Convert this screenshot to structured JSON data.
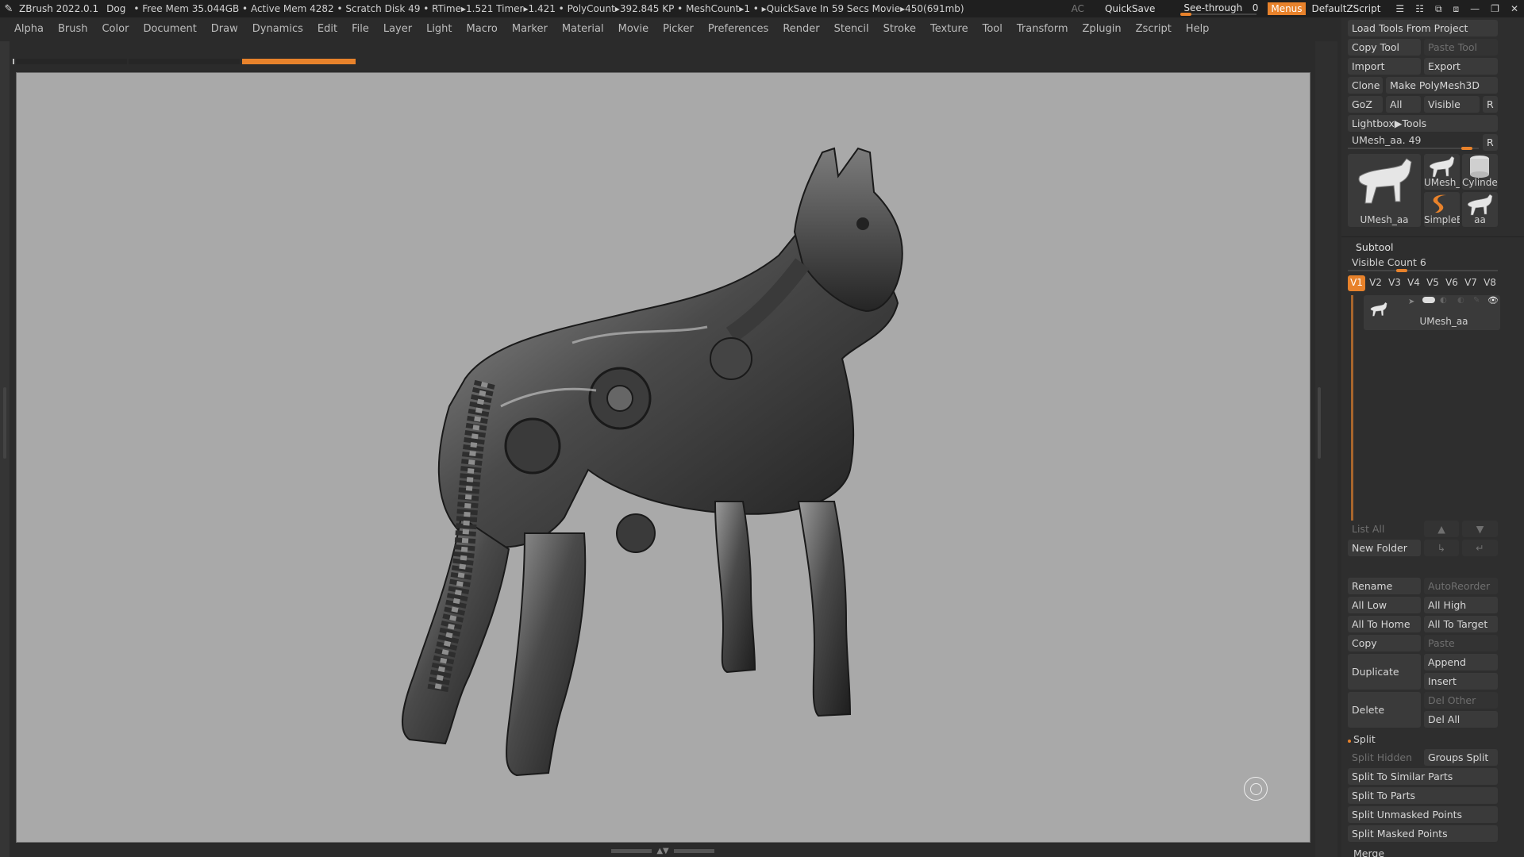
{
  "titlebar": {
    "app_name": "ZBrush 2022.0.1",
    "document": "Dog",
    "status": "• Free Mem 35.044GB • Active Mem 4282 • Scratch Disk 49 • RTime▸1.521 Timer▸1.421 • PolyCount▸392.845 KP • MeshCount▸1 • ▸QuickSave In 59 Secs Movie▸450(691mb)",
    "ac": "AC",
    "quicksave": "QuickSave",
    "see_through_label": "See-through",
    "see_through_value": "0",
    "see_through_level": 0,
    "menus": "Menus",
    "script": "DefaultZScript"
  },
  "menubar": [
    "Alpha",
    "Brush",
    "Color",
    "Document",
    "Draw",
    "Dynamics",
    "Edit",
    "File",
    "Layer",
    "Light",
    "Macro",
    "Marker",
    "Material",
    "Movie",
    "Picker",
    "Preferences",
    "Render",
    "Stencil",
    "Stroke",
    "Texture",
    "Tool",
    "Transform",
    "Zplugin",
    "Zscript",
    "Help"
  ],
  "colors": {
    "accent": "#e8822b",
    "canvas_bg": "#a9a9a9",
    "panel_bg": "#2e2e2e",
    "button_bg": "#3a3a3a"
  },
  "tool_panel": {
    "load_tools": "Load Tools From Project",
    "copy_tool": "Copy Tool",
    "paste_tool": "Paste Tool",
    "import": "Import",
    "export": "Export",
    "clone": "Clone",
    "make_polymesh": "Make PolyMesh3D",
    "goz": "GoZ",
    "all": "All",
    "visible": "Visible",
    "r": "R",
    "lightbox_tools": "Lightbox▶Tools",
    "current_tool": "UMesh_aa. 49",
    "current_tool_slider": 0.95,
    "thumbs": {
      "main": "UMesh_aa",
      "small1": "UMesh_",
      "small2": "Cylinder",
      "small3": "SimpleB",
      "small4": "aa"
    }
  },
  "subtool": {
    "title": "Subtool",
    "visible_count": "Visible Count 6",
    "visible_count_level": 0.35,
    "versions": [
      "V1",
      "V2",
      "V3",
      "V4",
      "V5",
      "V6",
      "V7",
      "V8"
    ],
    "active_version": "V1",
    "item_name": "UMesh_aa",
    "list_all": "List All",
    "new_folder": "New Folder",
    "rename": "Rename",
    "autoreorder": "AutoReorder",
    "all_low": "All Low",
    "all_high": "All High",
    "all_to_home": "All To Home",
    "all_to_target": "All To Target",
    "copy": "Copy",
    "paste": "Paste",
    "duplicate": "Duplicate",
    "append": "Append",
    "insert": "Insert",
    "delete": "Delete",
    "del_other": "Del Other",
    "del_all": "Del All",
    "split_title": "Split",
    "split_hidden": "Split Hidden",
    "groups_split": "Groups Split",
    "split_similar": "Split To Similar Parts",
    "split_parts": "Split To Parts",
    "split_unmasked": "Split Unmasked Points",
    "split_masked": "Split Masked Points",
    "merge": "Merge"
  }
}
